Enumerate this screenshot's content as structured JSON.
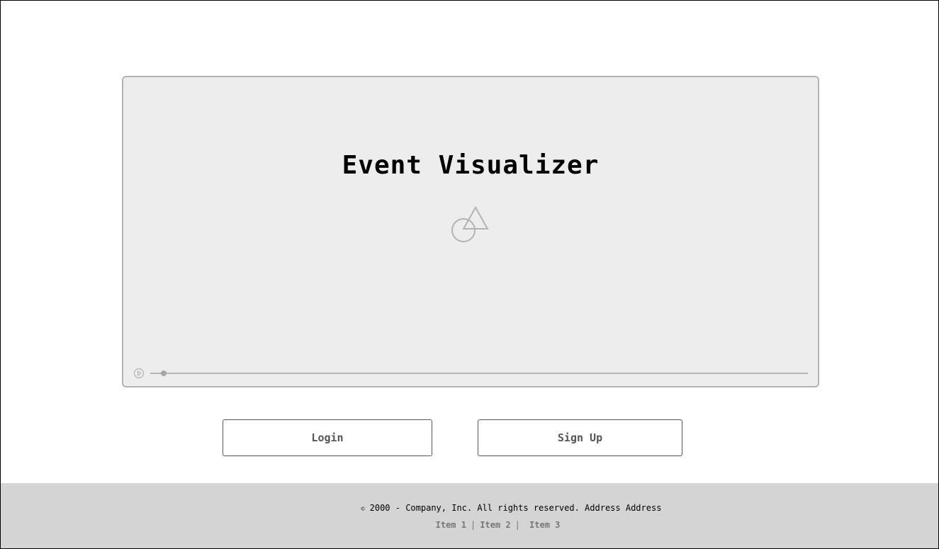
{
  "hero": {
    "title": "Event Visualizer",
    "media_icon": "shapes-placeholder-icon"
  },
  "player": {
    "play_icon": "play-icon",
    "progress": 0.02
  },
  "actions": {
    "login_label": "Login",
    "signup_label": "Sign Up"
  },
  "footer": {
    "copyright_symbol": "©",
    "copyright_text": "2000 - Company, Inc. All rights reserved. Address Address",
    "links": [
      "Item 1",
      "Item 2",
      "Item 3"
    ],
    "separator": "|"
  },
  "colors": {
    "panel_bg": "#ededed",
    "panel_border": "#b3b3b3",
    "footer_bg": "#d4d4d4",
    "button_border": "#555555"
  }
}
